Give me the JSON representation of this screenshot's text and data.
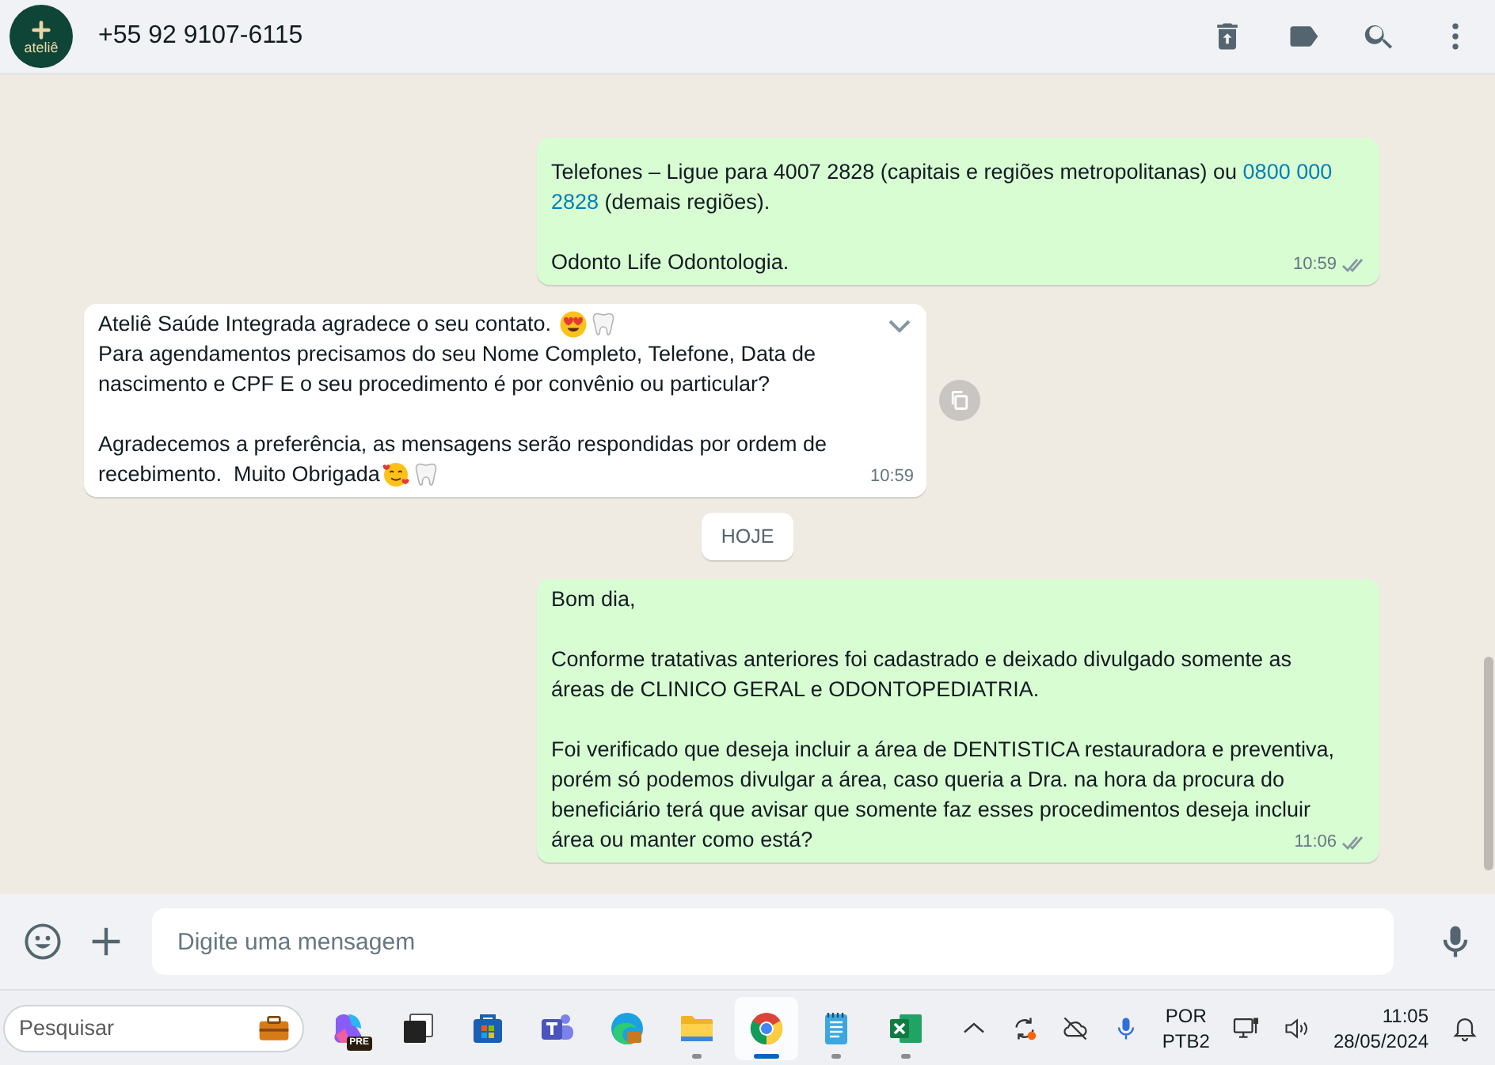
{
  "header": {
    "avatar_text": "ateliê",
    "contact": "+55 92 9107-6115"
  },
  "messages": [
    {
      "kind": "outgoing",
      "paragraphs": [
        [
          [
            "Telefones – Ligue para 4007 2828 (capitais e regiões metropolitanas) ou ",
            {
              "kind": "link",
              "text": "0800 000"
            }
          ],
          [
            {
              "kind": "link",
              "text": "2828"
            },
            " (demais regiões)."
          ]
        ],
        [
          [
            "Odonto Life Odontologia."
          ]
        ]
      ],
      "time": "10:59",
      "read": true,
      "hovered": false
    },
    {
      "kind": "incoming",
      "paragraphs": [
        [
          [
            "Ateliê Saúde Integrada agradece o seu contato. ",
            {
              "kind": "heart_eyes"
            },
            {
              "kind": "tooth"
            }
          ],
          [
            "Para agendamentos precisamos do seu Nome Completo, Telefone, Data de"
          ],
          [
            "nascimento e CPF E o seu procedimento é por convênio ou particular?"
          ]
        ],
        [
          [
            "Agradecemos a preferência, as mensagens serão respondidas por ordem de"
          ],
          [
            "recebimento.  Muito Obrigada",
            {
              "kind": "smiling_hearts"
            },
            {
              "kind": "tooth"
            }
          ]
        ]
      ],
      "time": "10:59",
      "read": false,
      "hovered": true
    },
    {
      "kind": "date",
      "label": "HOJE"
    },
    {
      "kind": "outgoing",
      "paragraphs": [
        [
          [
            "Bom dia,"
          ]
        ],
        [
          [
            "Conforme tratativas anteriores foi cadastrado e deixado divulgado somente as"
          ],
          [
            "áreas de CLINICO GERAL e ODONTOPEDIATRIA."
          ]
        ],
        [
          [
            "Foi verificado que deseja incluir a área de DENTISTICA restauradora e preventiva,"
          ],
          [
            "porém só podemos divulgar a área, caso queria a Dra. na hora da procura do"
          ],
          [
            "beneficiário terá que avisar que somente faz esses procedimentos deseja incluir"
          ],
          [
            "área ou manter como está?"
          ]
        ]
      ],
      "time": "11:06",
      "read": true,
      "hovered": false
    }
  ],
  "composer": {
    "placeholder": "Digite uma mensagem"
  },
  "taskbar": {
    "search": {
      "placeholder": "Pesquisar"
    },
    "apps": [
      {
        "kind": "copilot",
        "badge": "PRE",
        "running": false,
        "selected": false
      },
      {
        "kind": "taskview",
        "running": false,
        "selected": false
      },
      {
        "kind": "store",
        "running": false,
        "selected": false
      },
      {
        "kind": "teams",
        "running": false,
        "selected": false
      },
      {
        "kind": "edge",
        "running": false,
        "selected": false
      },
      {
        "kind": "explorer",
        "running": true,
        "selected": false
      },
      {
        "kind": "chrome",
        "running": true,
        "selected": true
      },
      {
        "kind": "notepad",
        "running": true,
        "selected": false
      },
      {
        "kind": "excel",
        "running": true,
        "selected": false
      }
    ],
    "language": "POR",
    "layout": "PTB2",
    "time": "11:05",
    "date": "28/05/2024"
  }
}
